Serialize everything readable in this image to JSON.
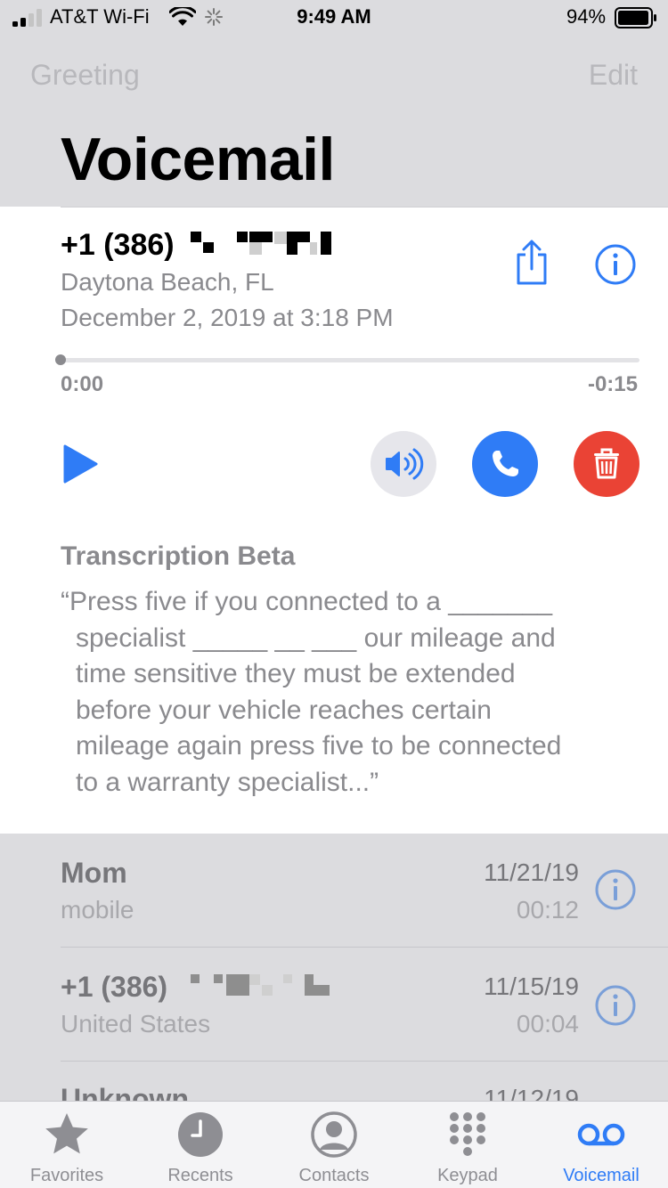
{
  "status_bar": {
    "carrier": "AT&T Wi-Fi",
    "time": "9:49 AM",
    "battery": "94%"
  },
  "nav": {
    "left_label": "Greeting",
    "right_label": "Edit",
    "title": "Voicemail"
  },
  "expanded": {
    "caller": "+1 (386)",
    "location": "Daytona Beach, FL",
    "datetime": "December 2, 2019 at 3:18 PM",
    "elapsed": "0:00",
    "remaining": "-0:15",
    "progress": 0,
    "transcription_title": "Transcription Beta",
    "transcription_lines": [
      "“Press five if you connected to a _______",
      "specialist _____ __ ___ our mileage and",
      "time sensitive they must be extended",
      "before your vehicle reaches certain",
      "mileage again press five to be connected",
      "to a warranty specialist...”"
    ]
  },
  "list": [
    {
      "name": "Mom",
      "sub": "mobile",
      "date": "11/21/19",
      "duration": "00:12"
    },
    {
      "name": "+1 (386)",
      "sub": "United States",
      "date": "11/15/19",
      "duration": "00:04"
    },
    {
      "name": "Unknown",
      "sub": "",
      "date": "11/12/19",
      "duration": ""
    }
  ],
  "tabs": [
    {
      "label": "Favorites",
      "icon": "star-icon"
    },
    {
      "label": "Recents",
      "icon": "clock-icon"
    },
    {
      "label": "Contacts",
      "icon": "person-circle-icon"
    },
    {
      "label": "Keypad",
      "icon": "keypad-icon"
    },
    {
      "label": "Voicemail",
      "icon": "voicemail-icon",
      "active": true
    }
  ],
  "colors": {
    "accent": "#2f7cf6",
    "delete": "#ea4335",
    "secondary_text": "#8a8a8e"
  }
}
